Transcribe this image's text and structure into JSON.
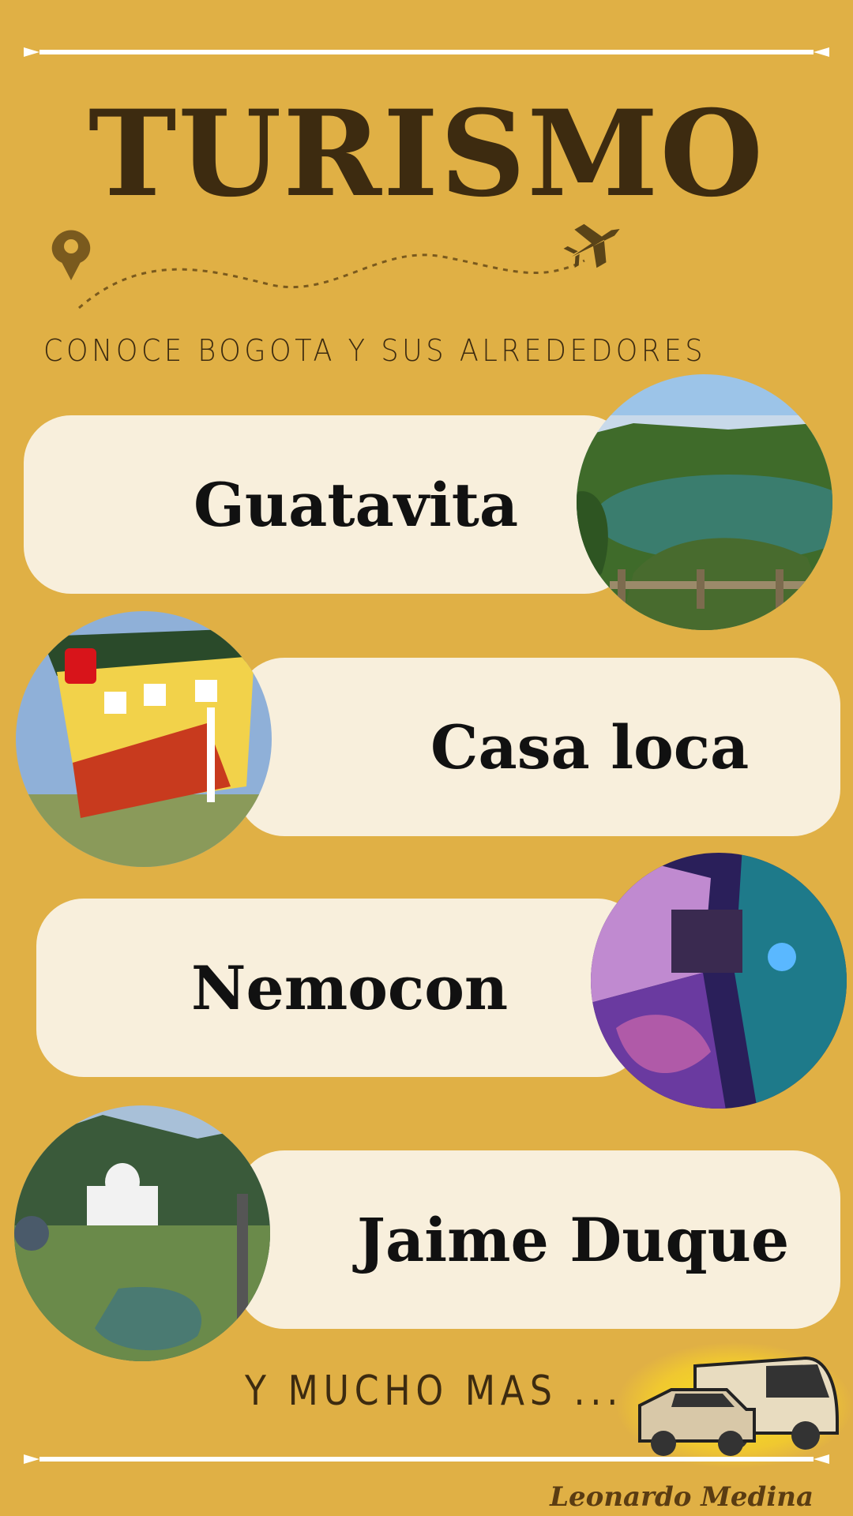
{
  "title": "TURISMO",
  "subtitle": "CONOCE BOGOTA Y SUS ALREDEDORES",
  "destinations": [
    {
      "name": "Guatavita",
      "icon": "lake-photo"
    },
    {
      "name": "Casa loca",
      "icon": "upside-down-house-photo"
    },
    {
      "name": "Nemocon",
      "icon": "salt-mine-photo"
    },
    {
      "name": "Jaime Duque",
      "icon": "theme-park-photo"
    }
  ],
  "footer": {
    "more": "Y MUCHO MAS ...",
    "author": "Leonardo Medina"
  },
  "icons": {
    "pin": "location-pin-icon",
    "plane": "airplane-icon",
    "vehicles": "car-and-van-icon"
  },
  "colors": {
    "background": "#e0b045",
    "pill": "#f8efdc",
    "title": "#3d2b10"
  }
}
